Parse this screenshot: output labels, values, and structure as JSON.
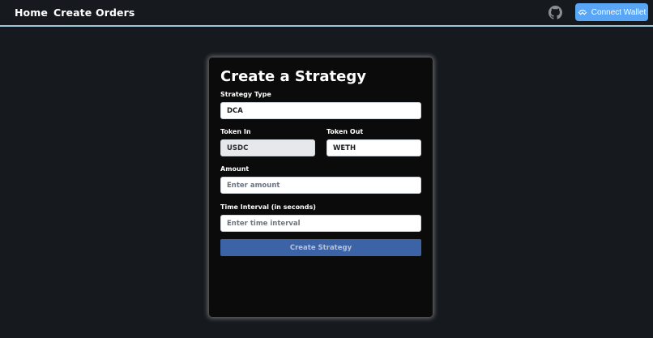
{
  "nav": {
    "links": [
      "Home",
      "Create",
      "Orders"
    ],
    "github_icon": "github-icon",
    "connect_wallet_label": "Connect Wallet",
    "wallet_icon": "walletconnect-icon"
  },
  "form": {
    "title": "Create a Strategy",
    "strategy_type": {
      "label": "Strategy Type",
      "value": "DCA"
    },
    "token_in": {
      "label": "Token In",
      "value": "USDC",
      "disabled": true
    },
    "token_out": {
      "label": "Token Out",
      "value": "WETH"
    },
    "amount": {
      "label": "Amount",
      "placeholder": "Enter amount"
    },
    "interval": {
      "label": "Time Interval (in seconds)",
      "placeholder": "Enter time interval"
    },
    "submit_label": "Create Strategy"
  },
  "colors": {
    "background": "#161a1e",
    "card": "#0b0b0c",
    "accent": "#5aa6f6",
    "submit": "#3b63a5",
    "nav_border": "#9cc7dc"
  }
}
